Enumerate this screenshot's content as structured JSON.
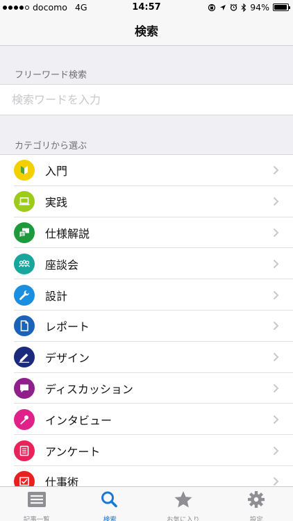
{
  "status_bar": {
    "carrier": "docomo",
    "network": "4G",
    "time": "14:57",
    "battery": "94%",
    "battery_level": 0.94
  },
  "nav": {
    "title": "検索"
  },
  "freeword": {
    "header": "フリーワード検索",
    "placeholder": "検索ワードを入力",
    "value": ""
  },
  "category": {
    "header": "カテゴリから選ぶ",
    "items": [
      {
        "label": "入門",
        "icon": "beginner-icon",
        "color": "#f5d000"
      },
      {
        "label": "実践",
        "icon": "laptop-icon",
        "color": "#9ccb19"
      },
      {
        "label": "仕様解説",
        "icon": "chat-doc-icon",
        "color": "#1e9a3c"
      },
      {
        "label": "座談会",
        "icon": "group-icon",
        "color": "#17a59c"
      },
      {
        "label": "設計",
        "icon": "wrench-icon",
        "color": "#1a8fe0"
      },
      {
        "label": "レポート",
        "icon": "document-icon",
        "color": "#1a63b8"
      },
      {
        "label": "デザイン",
        "icon": "pen-icon",
        "color": "#1a2a7c"
      },
      {
        "label": "ディスカッション",
        "icon": "speech-bubble-icon",
        "color": "#8f1f8a"
      },
      {
        "label": "インタビュー",
        "icon": "microphone-icon",
        "color": "#e0218a"
      },
      {
        "label": "アンケート",
        "icon": "survey-icon",
        "color": "#e8235a"
      },
      {
        "label": "仕事術",
        "icon": "checkbox-icon",
        "color": "#e82020"
      }
    ]
  },
  "tabs": [
    {
      "label": "記事一覧",
      "icon": "list-icon",
      "active": false
    },
    {
      "label": "検索",
      "icon": "search-icon",
      "active": true
    },
    {
      "label": "お気に入り",
      "icon": "star-icon",
      "active": false
    },
    {
      "label": "設定",
      "icon": "gear-icon",
      "active": false
    }
  ],
  "colors": {
    "accent": "#1878d8",
    "inactive": "#8e8e93"
  }
}
